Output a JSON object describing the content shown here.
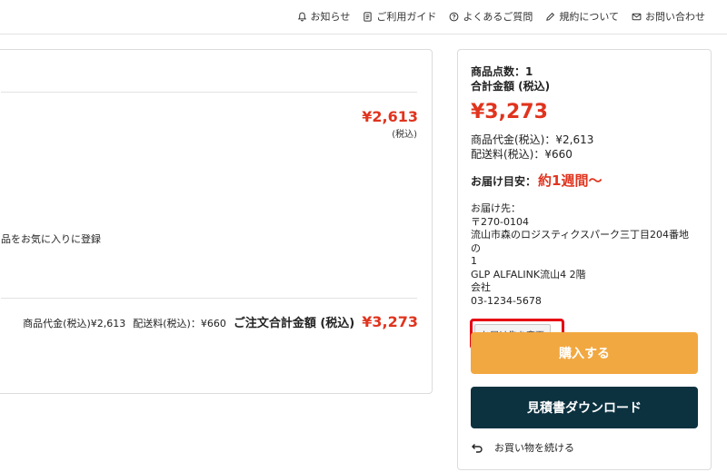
{
  "header": {
    "links": [
      {
        "icon": "bell-icon",
        "label": "お知らせ"
      },
      {
        "icon": "document-icon",
        "label": "ご利用ガイド"
      },
      {
        "icon": "question-circle-icon",
        "label": "よくあるご質問"
      },
      {
        "icon": "pencil-icon",
        "label": "規約について"
      },
      {
        "icon": "envelope-icon",
        "label": "お問い合わせ"
      }
    ]
  },
  "cart": {
    "item_price": "¥2,613",
    "item_tax_note": "(税込)",
    "favorite_text": "品をお気に入りに登録",
    "summary_subtotal": "商品代金(税込)¥2,613",
    "summary_shipping": "配送料(税込)：¥660",
    "summary_total_label": "ご注文合計金額 (税込)",
    "summary_total_value": "¥3,273"
  },
  "order": {
    "count_label": "商品点数：1",
    "total_label": "合計金額 (税込)",
    "grand_total": "¥3,273",
    "subtotal": "商品代金(税込)：¥2,613",
    "shipping": "配送料(税込)：¥660",
    "eta_label": "お届け目安：",
    "eta_value": "約1週間〜",
    "address_lines": {
      "l1": "お届け先：",
      "l2": "〒270-0104",
      "l3": "流山市森のロジスティクスパーク三丁目204番地の",
      "l4": "1",
      "l5": "GLP ALFALINK流山4 2階",
      "l6": "会社",
      "l7": "03-1234-5678"
    },
    "change_address_label": "お届け先を変更",
    "buy_label": "購入する",
    "quote_label": "見積書ダウンロード",
    "continue_label": "お買い物を続ける"
  },
  "colors": {
    "price_red": "#e0341e",
    "highlight_red": "#e60012",
    "buy_orange": "#f2a840",
    "quote_navy": "#0c3240"
  }
}
